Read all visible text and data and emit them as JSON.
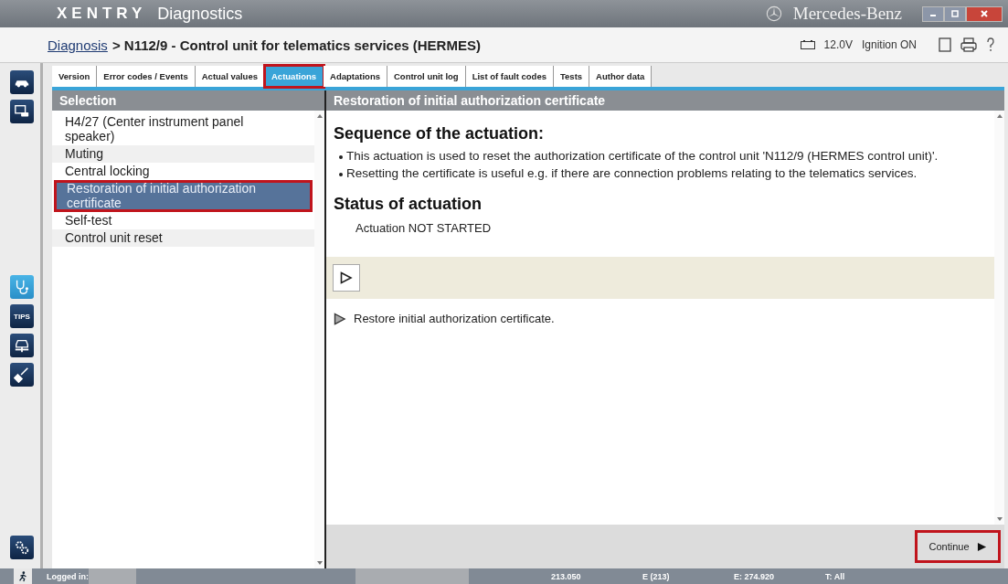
{
  "window": {
    "app_name": "XENTRY",
    "app_subtitle": "Diagnostics",
    "brand": "Mercedes-Benz"
  },
  "breadcrumb": {
    "link": "Diagnosis",
    "current": "> N112/9 - Control unit for telematics services (HERMES)"
  },
  "status_info": {
    "voltage": "12.0V",
    "ignition": "Ignition ON"
  },
  "sidebar": [
    {
      "kind": "car",
      "selected": false
    },
    {
      "kind": "computer",
      "selected": false
    },
    {
      "kind": "stethoscope",
      "selected": true
    },
    {
      "kind": "tips",
      "label": "TIPS",
      "selected": false
    },
    {
      "kind": "lift",
      "selected": false
    },
    {
      "kind": "tool",
      "selected": false
    }
  ],
  "tabs": [
    {
      "label": "Version",
      "selected": false,
      "highlighted": false
    },
    {
      "label": "Error codes / Events",
      "selected": false,
      "highlighted": false
    },
    {
      "label": "Actual values",
      "selected": false,
      "highlighted": false
    },
    {
      "label": "Actuations",
      "selected": true,
      "highlighted": true
    },
    {
      "label": "Adaptations",
      "selected": false,
      "highlighted": false
    },
    {
      "label": "Control unit log",
      "selected": false,
      "highlighted": false
    },
    {
      "label": "List of fault codes",
      "selected": false,
      "highlighted": false
    },
    {
      "label": "Tests",
      "selected": false,
      "highlighted": false
    },
    {
      "label": "Author data",
      "selected": false,
      "highlighted": false
    }
  ],
  "selection": {
    "title": "Selection",
    "items": [
      {
        "label": "H4/27 (Center instrument panel speaker)",
        "selected": false,
        "highlighted": false
      },
      {
        "label": "Muting",
        "selected": false,
        "highlighted": false
      },
      {
        "label": "Central locking",
        "selected": false,
        "highlighted": false
      },
      {
        "label": "Restoration of initial authorization certificate",
        "selected": true,
        "highlighted": true
      },
      {
        "label": "Self-test",
        "selected": false,
        "highlighted": false
      },
      {
        "label": "Control unit reset",
        "selected": false,
        "highlighted": false
      }
    ]
  },
  "content": {
    "title": "Restoration of initial authorization certificate",
    "sequence_heading": "Sequence of the actuation:",
    "bullets": [
      "This actuation is used to reset the authorization certificate of the control unit 'N112/9 (HERMES control unit)'.",
      "Resetting the certificate is useful e.g. if there are connection problems relating to the telematics services."
    ],
    "status_heading": "Status of actuation",
    "status_text": "Actuation NOT STARTED",
    "hint": "Restore initial authorization certificate.",
    "continue_button": {
      "label": "Continue",
      "highlighted": true
    }
  },
  "status_bar": {
    "logged_in": "Logged in:",
    "values": [
      "213.050",
      "E (213)",
      "E: 274.920",
      "T: All"
    ]
  }
}
